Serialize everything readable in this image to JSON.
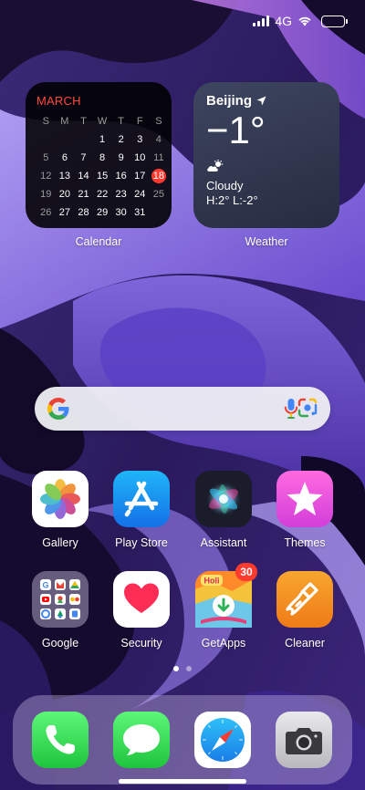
{
  "status_bar": {
    "network": "4G",
    "signal_level": 4,
    "battery_level": 0.0
  },
  "calendar": {
    "month": "MARCH",
    "weekdays": [
      "S",
      "M",
      "T",
      "W",
      "T",
      "F",
      "S"
    ],
    "weeks": [
      [
        "",
        "",
        "",
        "1",
        "2",
        "3",
        "4"
      ],
      [
        "5",
        "6",
        "7",
        "8",
        "9",
        "10",
        "11"
      ],
      [
        "12",
        "13",
        "14",
        "15",
        "16",
        "17",
        "18"
      ],
      [
        "19",
        "20",
        "21",
        "22",
        "23",
        "24",
        "25"
      ],
      [
        "26",
        "27",
        "28",
        "29",
        "30",
        "31",
        ""
      ]
    ],
    "today": "18",
    "label": "Calendar"
  },
  "weather": {
    "city": "Beijing",
    "temperature": "−1°",
    "condition": "Cloudy",
    "range": "H:2° L:-2°",
    "label": "Weather"
  },
  "apps": [
    {
      "label": "Gallery",
      "icon": "gallery-icon"
    },
    {
      "label": "Play Store",
      "icon": "app-store-icon"
    },
    {
      "label": "Assistant",
      "icon": "siri-icon"
    },
    {
      "label": "Themes",
      "icon": "star-icon"
    },
    {
      "label": "Google",
      "icon": "google-folder-icon"
    },
    {
      "label": "Security",
      "icon": "heart-icon"
    },
    {
      "label": "GetApps",
      "icon": "getapps-icon",
      "badge": "30",
      "banner": "Holi"
    },
    {
      "label": "Cleaner",
      "icon": "broom-icon"
    }
  ],
  "pages": {
    "count": 2,
    "current": 0
  },
  "dock": [
    {
      "icon": "phone-icon"
    },
    {
      "icon": "messages-icon"
    },
    {
      "icon": "compass-icon"
    },
    {
      "icon": "camera-icon"
    }
  ],
  "colors": {
    "calendar_accent": "#ff3b30",
    "wallpaper_base": "#1a0f3a",
    "wallpaper_accent": "#8c6cf0"
  }
}
